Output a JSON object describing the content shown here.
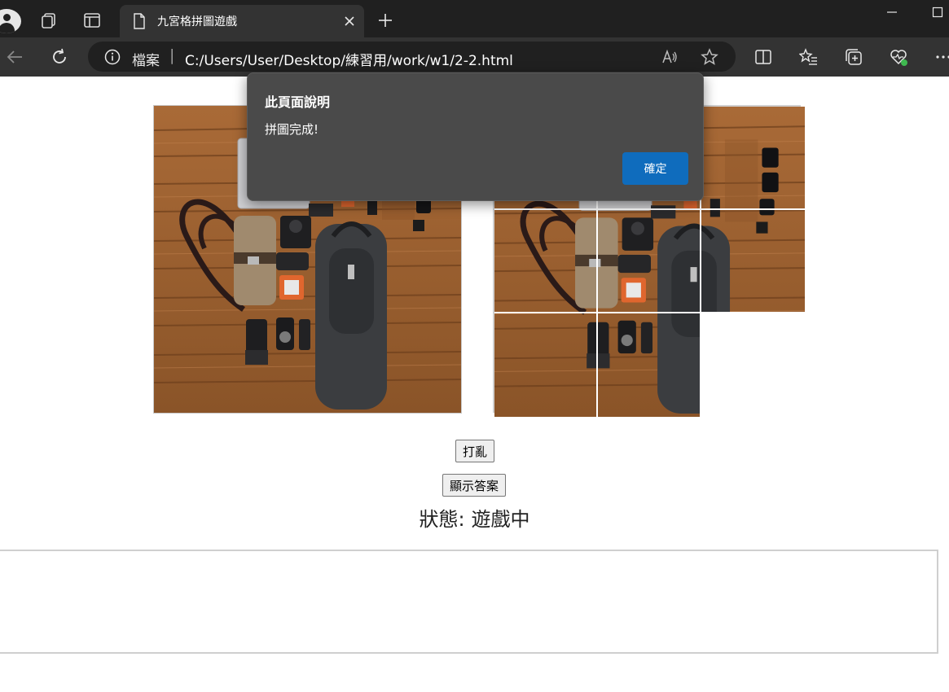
{
  "browser": {
    "tab_title": "九宮格拼圖遊戲",
    "address_label": "檔案",
    "address_separator": "|",
    "url": "C:/Users/User/Desktop/練習用/work/w1/2-2.html"
  },
  "page": {
    "shuffle_label": "打亂",
    "show_answer_label": "顯示答案",
    "status_label": "狀態:",
    "status_value": "遊戲中",
    "answer_image": "camera-gear-flatlay-photo",
    "puzzle": {
      "grid": "3x3",
      "empty_cell": 9
    }
  },
  "dialog": {
    "title": "此頁面說明",
    "message": "拼圖完成!",
    "ok_label": "確定"
  },
  "colors": {
    "accent": "#0f6cbd",
    "chrome_dark": "#202020",
    "chrome": "#333333",
    "dialog_bg": "#4a4a4a",
    "wood": "#9a5f30"
  }
}
